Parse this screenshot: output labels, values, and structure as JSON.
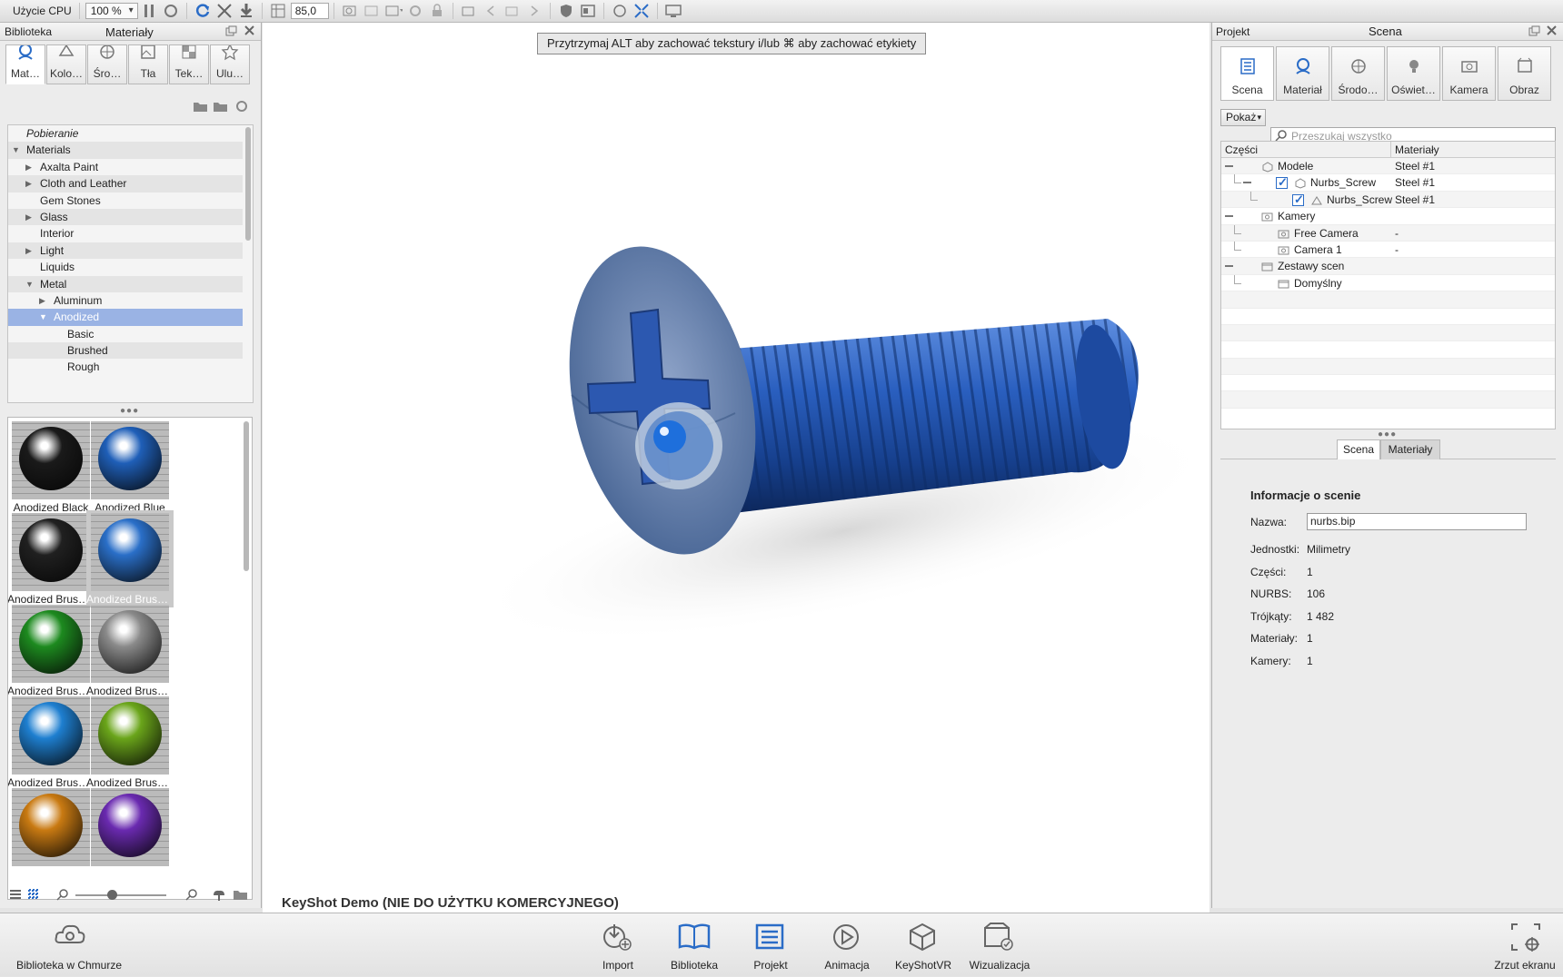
{
  "toolbar": {
    "cpu_label": "Użycie CPU",
    "cpu_value": "100 %",
    "fov_value": "85,0"
  },
  "left_panel": {
    "title": "Biblioteka",
    "subtitle": "Materiały",
    "tabs": [
      {
        "label": "Mat…",
        "icon": "material-icon"
      },
      {
        "label": "Kolo…",
        "icon": "colors-icon"
      },
      {
        "label": "Śro…",
        "icon": "environment-icon"
      },
      {
        "label": "Tła",
        "icon": "backgrounds-icon"
      },
      {
        "label": "Tek…",
        "icon": "textures-icon"
      },
      {
        "label": "Ulu…",
        "icon": "favorites-icon"
      }
    ],
    "search_placeholder": "",
    "tree": [
      {
        "label": "Pobieranie",
        "indent": 0,
        "arrow": "",
        "italic": true
      },
      {
        "label": "Materials",
        "indent": 0,
        "arrow": "down"
      },
      {
        "label": "Axalta Paint",
        "indent": 1,
        "arrow": "right"
      },
      {
        "label": "Cloth and Leather",
        "indent": 1,
        "arrow": "right"
      },
      {
        "label": "Gem Stones",
        "indent": 1,
        "arrow": ""
      },
      {
        "label": "Glass",
        "indent": 1,
        "arrow": "right"
      },
      {
        "label": "Interior",
        "indent": 1,
        "arrow": ""
      },
      {
        "label": "Light",
        "indent": 1,
        "arrow": "right"
      },
      {
        "label": "Liquids",
        "indent": 1,
        "arrow": ""
      },
      {
        "label": "Metal",
        "indent": 1,
        "arrow": "down"
      },
      {
        "label": "Aluminum",
        "indent": 2,
        "arrow": "right"
      },
      {
        "label": "Anodized",
        "indent": 2,
        "arrow": "down",
        "selected": true
      },
      {
        "label": "Basic",
        "indent": 3,
        "arrow": ""
      },
      {
        "label": "Brushed",
        "indent": 3,
        "arrow": ""
      },
      {
        "label": "Rough",
        "indent": 3,
        "arrow": ""
      }
    ],
    "thumbnails": [
      {
        "label": "Anodized Black",
        "color": "#1a1a1a"
      },
      {
        "label": "Anodized Blue",
        "color": "#1f5fb8"
      },
      {
        "label": "Anodized Brush…",
        "color": "#202020"
      },
      {
        "label": "Anodized Brush…",
        "color": "#2a6fc8",
        "selected": true
      },
      {
        "label": "Anodized Brush…",
        "color": "#1d8a1f"
      },
      {
        "label": "Anodized Brush…",
        "color": "#8a8a8a"
      },
      {
        "label": "Anodized Brush…",
        "color": "#1e7fd0"
      },
      {
        "label": "Anodized Brush…",
        "color": "#6aa51a"
      },
      {
        "label": "",
        "color": "#c97a12"
      },
      {
        "label": "",
        "color": "#6a2ab0"
      }
    ]
  },
  "viewport": {
    "hint": "Przytrzymaj ALT aby zachować tekstury i/lub ⌘ aby zachować etykiety",
    "demo_label": "KeyShot Demo (NIE DO UŻYTKU KOMERCYJNEGO)"
  },
  "right_panel": {
    "title_left": "Projekt",
    "title_center": "Scena",
    "tabs": [
      {
        "label": "Scena",
        "icon": "scene-icon"
      },
      {
        "label": "Materiał",
        "icon": "material-icon"
      },
      {
        "label": "Środo…",
        "icon": "environment-icon"
      },
      {
        "label": "Oświet…",
        "icon": "lighting-icon"
      },
      {
        "label": "Kamera",
        "icon": "camera-icon"
      },
      {
        "label": "Obraz",
        "icon": "image-icon"
      }
    ],
    "show_button": "Pokaż",
    "search_placeholder": "Przeszukaj wszystko",
    "col_parts": "Części",
    "col_materials": "Materiały",
    "scene_tree": [
      {
        "label": "Modele",
        "material": "Steel #1",
        "indent": 0,
        "check": false,
        "icon": "model-icon"
      },
      {
        "label": "Nurbs_Screw",
        "material": "Steel #1",
        "indent": 1,
        "check": true,
        "icon": "model-icon"
      },
      {
        "label": "Nurbs_Screw",
        "material": "Steel #1",
        "indent": 2,
        "check": true,
        "icon": "mesh-icon"
      },
      {
        "label": "Kamery",
        "material": "",
        "indent": 0,
        "check": false,
        "icon": "camera-icon"
      },
      {
        "label": "Free Camera",
        "material": "-",
        "indent": 1,
        "check": false,
        "icon": "camera-icon"
      },
      {
        "label": "Camera 1",
        "material": "-",
        "indent": 1,
        "check": false,
        "icon": "camera-icon"
      },
      {
        "label": "Zestawy scen",
        "material": "",
        "indent": 0,
        "check": false,
        "icon": "sceneset-icon"
      },
      {
        "label": "Domyślny",
        "material": "",
        "indent": 1,
        "check": false,
        "icon": "sceneset-icon"
      }
    ],
    "sub_tabs": [
      "Scena",
      "Materiały"
    ],
    "info": {
      "heading": "Informacje o scenie",
      "name_label": "Nazwa:",
      "name_value": "nurbs.bip",
      "rows": [
        {
          "label": "Jednostki:",
          "value": "Milimetry"
        },
        {
          "label": "Części:",
          "value": "1"
        },
        {
          "label": "NURBS:",
          "value": "106"
        },
        {
          "label": "Trójkąty:",
          "value": "1 482"
        },
        {
          "label": "Materiały:",
          "value": "1"
        },
        {
          "label": "Kamery:",
          "value": "1"
        }
      ]
    }
  },
  "dock": {
    "cloud_library": "Biblioteka w Chmurze",
    "buttons": [
      {
        "label": "Import",
        "icon": "import-icon"
      },
      {
        "label": "Biblioteka",
        "icon": "library-icon"
      },
      {
        "label": "Projekt",
        "icon": "project-icon"
      },
      {
        "label": "Animacja",
        "icon": "animation-icon"
      },
      {
        "label": "KeyShotVR",
        "icon": "keyshotvr-icon"
      },
      {
        "label": "Wizualizacja",
        "icon": "render-icon"
      }
    ],
    "screenshot": "Zrzut ekranu"
  }
}
